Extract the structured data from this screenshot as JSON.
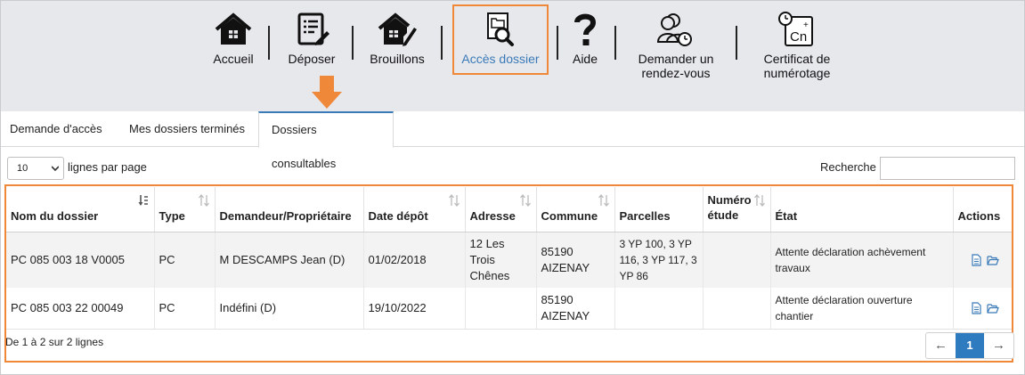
{
  "nav": {
    "items": [
      {
        "label": "Accueil",
        "icon": "home-icon"
      },
      {
        "label": "Déposer",
        "icon": "edit-document-icon"
      },
      {
        "label": "Brouillons",
        "icon": "draft-house-icon"
      },
      {
        "label": "Accès dossier",
        "icon": "folder-search-icon"
      },
      {
        "label": "Aide",
        "icon": "question-icon"
      },
      {
        "label": "Demander un rendez-vous",
        "icon": "user-clock-icon"
      },
      {
        "label": "Certificat de numérotage",
        "icon": "certificate-clock-icon"
      }
    ],
    "active_index": 3,
    "highlight_color": "#f0883a"
  },
  "tabs": [
    {
      "label": "Demande d'accès"
    },
    {
      "label": "Mes dossiers terminés"
    },
    {
      "label": "Dossiers consultables"
    }
  ],
  "active_tab": 2,
  "controls": {
    "page_size": "10",
    "per_page_label": "lignes par page",
    "search_label": "Recherche",
    "search_value": ""
  },
  "table": {
    "columns": [
      "Nom du dossier",
      "Type",
      "Demandeur/Propriétaire",
      "Date dépôt",
      "Adresse",
      "Commune",
      "Parcelles",
      "Numéro étude",
      "État",
      "Actions"
    ],
    "rows": [
      {
        "nom": "PC 085 003 18 V0005",
        "type": "PC",
        "demandeur": "M DESCAMPS Jean (D)",
        "date": "01/02/2018",
        "adresse": "12 Les Trois Chênes",
        "commune": "85190 AIZENAY",
        "parcelles": "3 YP 100, 3 YP 116, 3 YP 117, 3 YP 86",
        "numero": "",
        "etat": "Attente déclaration achèvement travaux"
      },
      {
        "nom": "PC 085 003 22 00049",
        "type": "PC",
        "demandeur": "Indéfini (D)",
        "date": "19/10/2022",
        "adresse": "",
        "commune": "85190 AIZENAY",
        "parcelles": "",
        "numero": "",
        "etat": "Attente déclaration ouverture chantier"
      }
    ]
  },
  "footer": {
    "info": "De 1 à 2 sur 2 lignes",
    "prev": "←",
    "page": "1",
    "next": "→"
  },
  "colors": {
    "accent_blue": "#2f7bbf",
    "highlight_orange": "#f0883a",
    "nav_background": "#e6e8ec"
  }
}
